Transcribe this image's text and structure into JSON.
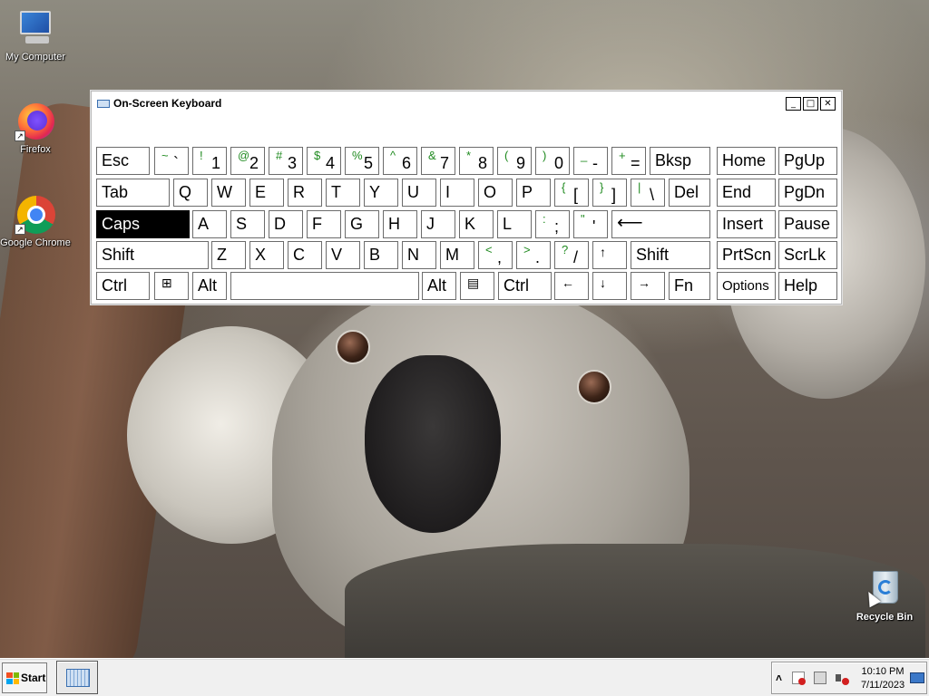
{
  "desktop": {
    "icons": [
      {
        "label": "My Computer"
      },
      {
        "label": "Firefox"
      },
      {
        "label": "Google Chrome"
      },
      {
        "label": "Recycle Bin"
      }
    ]
  },
  "osk": {
    "title": "On-Screen Keyboard",
    "window_buttons": {
      "minimize": "_",
      "maximize": "□",
      "close": "✕"
    },
    "rows": {
      "r1": {
        "esc": "Esc",
        "backtick": {
          "shift": "~",
          "base": "`"
        },
        "k1": {
          "shift": "!",
          "base": "1"
        },
        "k2": {
          "shift": "@",
          "base": "2"
        },
        "k3": {
          "shift": "#",
          "base": "3"
        },
        "k4": {
          "shift": "$",
          "base": "4"
        },
        "k5": {
          "shift": "%",
          "base": "5"
        },
        "k6": {
          "shift": "^",
          "base": "6"
        },
        "k7": {
          "shift": "&",
          "base": "7"
        },
        "k8": {
          "shift": "*",
          "base": "8"
        },
        "k9": {
          "shift": "(",
          "base": "9"
        },
        "k0": {
          "shift": ")",
          "base": "0"
        },
        "minus": {
          "shift": "_",
          "base": "-"
        },
        "equals": {
          "shift": "+",
          "base": "="
        },
        "bksp": "Bksp",
        "home": "Home",
        "pgup": "PgUp"
      },
      "r2": {
        "tab": "Tab",
        "q": "Q",
        "w": "W",
        "e": "E",
        "r": "R",
        "t": "T",
        "y": "Y",
        "u": "U",
        "i": "I",
        "o": "O",
        "p": "P",
        "lbracket": {
          "shift": "{",
          "base": "["
        },
        "rbracket": {
          "shift": "}",
          "base": "]"
        },
        "backslash": {
          "shift": "|",
          "base": "\\"
        },
        "del": "Del",
        "end": "End",
        "pgdn": "PgDn"
      },
      "r3": {
        "caps": "Caps",
        "a": "A",
        "s": "S",
        "d": "D",
        "f": "F",
        "g": "G",
        "h": "H",
        "j": "J",
        "k": "K",
        "l": "L",
        "semicolon": {
          "shift": ":",
          "base": ";"
        },
        "quote": {
          "shift": "\"",
          "base": "'"
        },
        "enter": "⟵",
        "insert": "Insert",
        "pause": "Pause"
      },
      "r4": {
        "shift_l": "Shift",
        "z": "Z",
        "x": "X",
        "c": "C",
        "v": "V",
        "b": "B",
        "n": "N",
        "m": "M",
        "comma": {
          "shift": "<",
          "base": ","
        },
        "period": {
          "shift": ">",
          "base": "."
        },
        "slash": {
          "shift": "?",
          "base": "/"
        },
        "up": "↑",
        "shift_r": "Shift",
        "prtscn": "PrtScn",
        "scrlk": "ScrLk"
      },
      "r5": {
        "ctrl_l": "Ctrl",
        "win": "⊞",
        "alt_l": "Alt",
        "space": "",
        "alt_r": "Alt",
        "menu": "▤",
        "ctrl_r": "Ctrl",
        "left": "←",
        "down": "↓",
        "right": "→",
        "fn": "Fn",
        "options": "Options",
        "help": "Help"
      }
    },
    "caps_active": true
  },
  "taskbar": {
    "start_label": "Start",
    "tray": {
      "chevron": "˄",
      "time": "10:10 PM",
      "date": "7/11/2023"
    }
  },
  "colors": {
    "shift_legend": "#1f8a1f",
    "active_key_bg": "#000000",
    "taskbar_bg": "#f0f0f0"
  }
}
